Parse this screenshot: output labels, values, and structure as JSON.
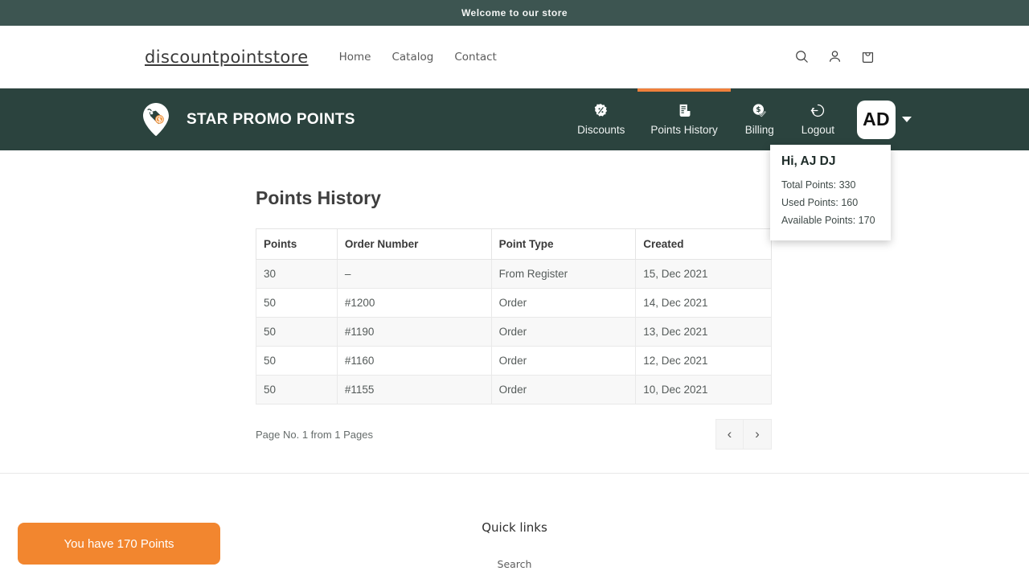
{
  "announcement": {
    "text": "Welcome to our store"
  },
  "store_header": {
    "logo": "discountpointstore",
    "nav": [
      {
        "label": "Home"
      },
      {
        "label": "Catalog"
      },
      {
        "label": "Contact"
      }
    ],
    "icons": [
      {
        "name": "search-icon"
      },
      {
        "name": "account-icon"
      },
      {
        "name": "cart-icon"
      }
    ]
  },
  "app_nav": {
    "brand_title": "STAR PROMO POINTS",
    "brand_logo_icon": "location-pin-price-tag-icon",
    "items": [
      {
        "label": "Discounts",
        "icon": "percent-badge-icon",
        "active": false
      },
      {
        "label": "Points History",
        "icon": "receipt-icon",
        "active": true
      },
      {
        "label": "Billing",
        "icon": "dollar-check-icon",
        "active": false
      },
      {
        "label": "Logout",
        "icon": "logout-arrow-icon",
        "active": false
      }
    ],
    "avatar_initials": "AD",
    "caret_icon": "caret-down-icon"
  },
  "user_dropdown": {
    "greeting": "Hi, AJ DJ",
    "total_points": "Total Points: 330",
    "used_points": "Used Points: 160",
    "available_points": "Available Points: 170"
  },
  "main": {
    "title": "Points History",
    "table": {
      "columns": [
        "Points",
        "Order Number",
        "Point Type",
        "Created"
      ],
      "rows": [
        [
          "30",
          "–",
          "From Register",
          "15, Dec 2021"
        ],
        [
          "50",
          "#1200",
          "Order",
          "14, Dec 2021"
        ],
        [
          "50",
          "#1190",
          "Order",
          "13, Dec 2021"
        ],
        [
          "50",
          "#1160",
          "Order",
          "12, Dec 2021"
        ],
        [
          "50",
          "#1155",
          "Order",
          "10, Dec 2021"
        ]
      ]
    },
    "pagination": {
      "text": "Page No. 1 from 1 Pages",
      "prev_label": "‹",
      "next_label": "›"
    }
  },
  "footer": {
    "heading": "Quick links",
    "links": [
      {
        "label": "Search"
      }
    ]
  },
  "points_badge": {
    "label": "You have 170 Points"
  },
  "colors": {
    "announcement_bg": "#3d5551",
    "app_nav_bg": "#2b433e",
    "accent_orange": "#f0803c",
    "badge_orange": "#f2862f",
    "page_bg": "#ffffff"
  }
}
